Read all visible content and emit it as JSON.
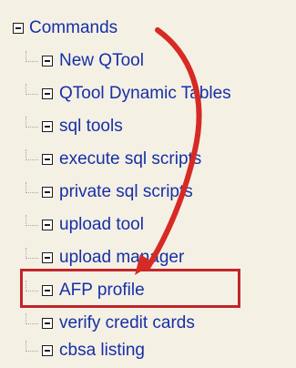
{
  "tree": {
    "root": {
      "label": "Commands",
      "expanded": true
    },
    "items": [
      {
        "label": "New QTool"
      },
      {
        "label": "QTool Dynamic Tables"
      },
      {
        "label": "sql tools"
      },
      {
        "label": "execute sql scripts"
      },
      {
        "label": "private sql scripts"
      },
      {
        "label": "upload tool"
      },
      {
        "label": "upload manager"
      },
      {
        "label": "AFP profile",
        "highlighted": true
      },
      {
        "label": "verify credit cards"
      },
      {
        "label": "cbsa listing"
      }
    ]
  },
  "annotation": {
    "highlight_color": "#c0262a",
    "arrow_color": "#d62a24"
  },
  "colors": {
    "background": "#f5f0e4",
    "link": "#1530a8",
    "tree_lines": "#a8a8a8"
  }
}
